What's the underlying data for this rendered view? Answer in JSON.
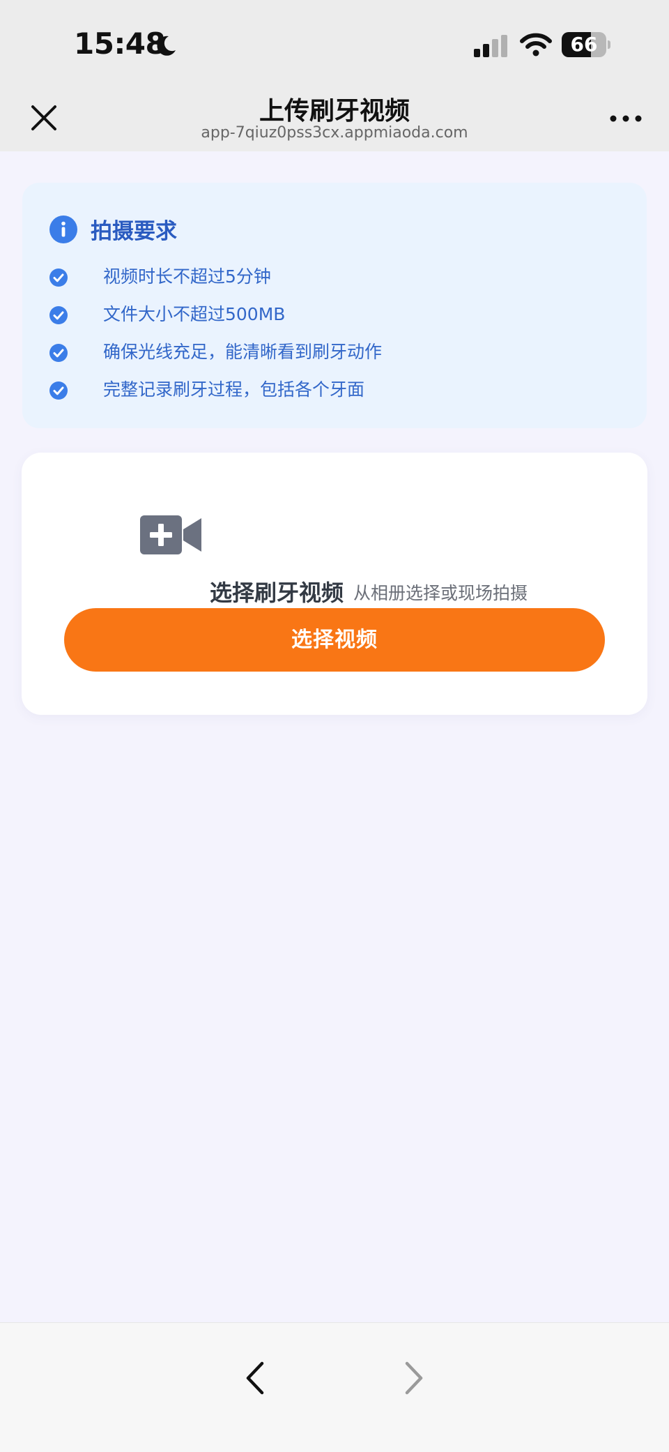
{
  "status_bar": {
    "time": "15:48",
    "battery_level": "66",
    "battery_fraction": 0.66,
    "icons": [
      "moon-icon",
      "signal-icon",
      "wifi-icon",
      "battery-icon"
    ]
  },
  "nav": {
    "title": "上传刷牙视频",
    "url": "app-7qiuz0pss3cx.appmiaoda.com",
    "close_icon": "close-icon",
    "more_icon": "more-icon"
  },
  "requirements": {
    "title": "拍摄要求",
    "icon": "info-icon",
    "items": [
      "视频时长不超过5分钟",
      "文件大小不超过500MB",
      "确保光线充足，能清晰看到刷牙动作",
      "完整记录刷牙过程，包括各个牙面"
    ],
    "item_icon": "check-circle-icon"
  },
  "upload": {
    "icon": "video-add-icon",
    "title": "选择刷牙视频",
    "subtitle": "从相册选择或现场拍摄",
    "button_label": "选择视频"
  },
  "bottom_nav": {
    "back_icon": "chevron-left-icon",
    "forward_icon": "chevron-right-icon"
  },
  "colors": {
    "accent_orange": "#f97615",
    "info_blue": "#3b7de8",
    "text_blue": "#3267c9",
    "card_blue_bg": "#eaf3fe",
    "page_bg": "#f4f3fd"
  }
}
